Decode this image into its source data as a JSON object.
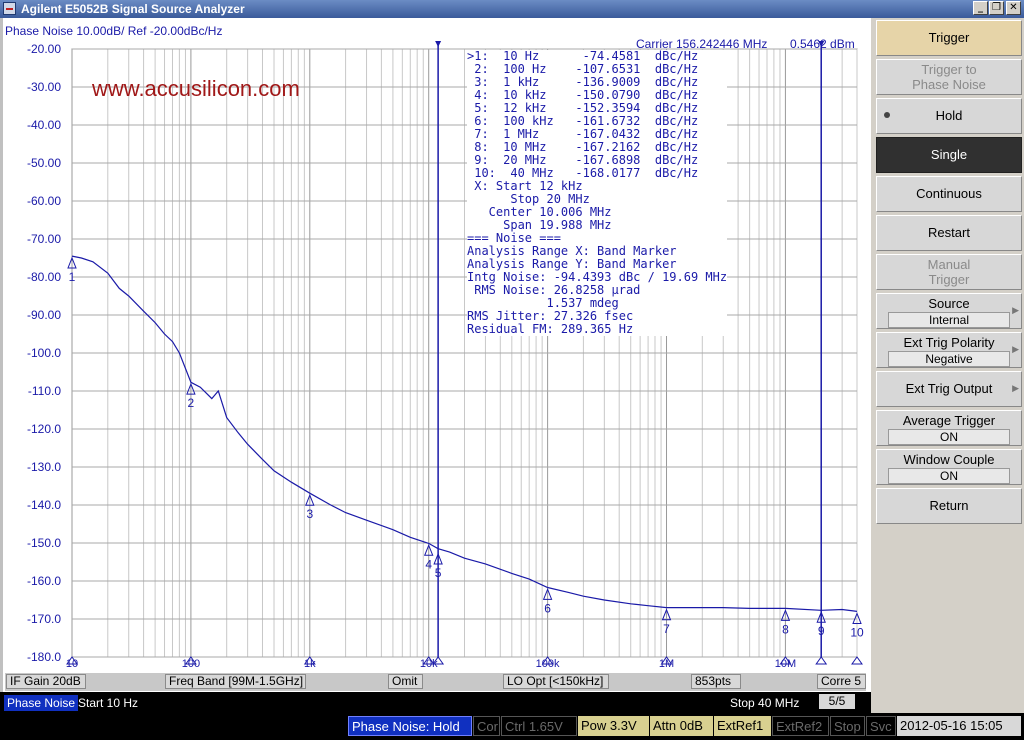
{
  "window": {
    "title": "Agilent E5052B Signal Source Analyzer"
  },
  "chart": {
    "header": "Phase Noise 10.00dB/ Ref -20.00dBc/Hz",
    "carrier": "Carrier 156.242446 MHz",
    "carrier_level": "0.5462 dBm",
    "watermark": "www.accusilicon.com"
  },
  "markers_table": [
    ">1:  10 Hz      -74.4581  dBc/Hz",
    " 2:  100 Hz    -107.6531  dBc/Hz",
    " 3:  1 kHz     -136.9009  dBc/Hz",
    " 4:  10 kHz    -150.0790  dBc/Hz",
    " 5:  12 kHz    -152.3594  dBc/Hz",
    " 6:  100 kHz   -161.6732  dBc/Hz",
    " 7:  1 MHz     -167.0432  dBc/Hz",
    " 8:  10 MHz    -167.2162  dBc/Hz",
    " 9:  20 MHz    -167.6898  dBc/Hz",
    " 10:  40 MHz   -168.0177  dBc/Hz",
    " X: Start 12 kHz",
    "      Stop 20 MHz",
    "   Center 10.006 MHz",
    "     Span 19.988 MHz",
    "=== Noise ===",
    "Analysis Range X: Band Marker",
    "Analysis Range Y: Band Marker",
    "Intg Noise: -94.4393 dBc / 19.69 MHz",
    " RMS Noise: 26.8258 µrad",
    "           1.537 mdeg",
    "RMS Jitter: 27.326 fsec",
    "Residual FM: 289.365 Hz"
  ],
  "chart_data": {
    "type": "line",
    "title": "Phase Noise 10.00dB/ Ref -20.00dBc/Hz",
    "xscale": "log",
    "xlim": [
      10,
      40000000
    ],
    "ylim": [
      -180,
      -20
    ],
    "yticks": [
      -20,
      -30,
      -40,
      -50,
      -60,
      -70,
      -80,
      -90,
      -100,
      -110,
      -120,
      -130,
      -140,
      -150,
      -160,
      -170,
      -180
    ],
    "ytick_labels": [
      "-20.00",
      "-30.00",
      "-40.00",
      "-50.00",
      "-60.00",
      "-70.00",
      "-80.00",
      "-90.00",
      "-100.0",
      "-110.0",
      "-120.0",
      "-130.0",
      "-140.0",
      "-150.0",
      "-160.0",
      "-170.0",
      "-180.0"
    ],
    "xticks": [
      10,
      100,
      1000,
      10000,
      100000,
      1000000,
      10000000
    ],
    "xtick_labels": [
      "10",
      "100",
      "1k",
      "10k",
      "100k",
      "1M",
      "10M"
    ],
    "grid": true,
    "series": [
      {
        "color": "#1a1aa8",
        "x": [
          10,
          12,
          15,
          20,
          25,
          30,
          40,
          50,
          60,
          70,
          80,
          100,
          120,
          150,
          170,
          200,
          250,
          300,
          400,
          500,
          700,
          1000,
          1500,
          2000,
          3000,
          5000,
          7000,
          10000,
          12000,
          15000,
          20000,
          30000,
          50000,
          70000,
          100000,
          150000,
          200000,
          300000,
          500000,
          700000,
          1000000,
          2000000,
          3000000,
          5000000,
          7000000,
          10000000,
          20000000,
          30000000,
          40000000
        ],
        "y": [
          -74.5,
          -75,
          -76,
          -79,
          -83,
          -85,
          -89,
          -92,
          -95,
          -97,
          -100,
          -107.7,
          -109,
          -112,
          -110,
          -117,
          -121,
          -124,
          -128,
          -131,
          -134,
          -136.9,
          -140,
          -142,
          -144,
          -146.5,
          -148.5,
          -150.1,
          -151.5,
          -152.4,
          -154,
          -155.5,
          -158,
          -159.5,
          -161.7,
          -163,
          -164,
          -165,
          -166,
          -166.5,
          -167.0,
          -167,
          -167,
          -167.2,
          -167.2,
          -167.2,
          -167.7,
          -167.5,
          -168
        ]
      }
    ],
    "markers": [
      {
        "label": "1",
        "x": 10,
        "y": -74.4581
      },
      {
        "label": "2",
        "x": 100,
        "y": -107.6531
      },
      {
        "label": "3",
        "x": 1000,
        "y": -136.9009
      },
      {
        "label": "4",
        "x": 10000,
        "y": -150.079
      },
      {
        "label": "5",
        "x": 12000,
        "y": -152.3594
      },
      {
        "label": "6",
        "x": 100000,
        "y": -161.6732
      },
      {
        "label": "7",
        "x": 1000000,
        "y": -167.0432
      },
      {
        "label": "8",
        "x": 10000000,
        "y": -167.2162
      },
      {
        "label": "9",
        "x": 20000000,
        "y": -167.6898
      },
      {
        "label": "10",
        "x": 40000000,
        "y": -168.0177
      }
    ],
    "band_lines": [
      12000,
      20000000
    ]
  },
  "status_row": {
    "if_gain": "IF Gain 20dB",
    "freq_band": "Freq Band [99M-1.5GHz]",
    "omit": "Omit",
    "lo_opt": "LO Opt [<150kHz]",
    "points": "853pts",
    "corr": "Corre 5"
  },
  "sweep_row": {
    "mode": "Phase Noise",
    "start": "Start 10 Hz",
    "stop": "Stop 40 MHz",
    "page": "5/5"
  },
  "bottom_bar": {
    "measure": "Phase Noise: Hold",
    "cor": "Cor",
    "ctrl": "Ctrl  1.65V",
    "pow": "Pow  3.3V",
    "attn": "Attn 0dB",
    "extref1": "ExtRef1",
    "extref2": "ExtRef2",
    "stop": "Stop",
    "svc": "Svc",
    "datetime": "2012-05-16 15:05"
  },
  "softkeys": {
    "title": "Trigger",
    "trigger_to_pn": "Trigger to Phase Noise",
    "hold": "Hold",
    "single": "Single",
    "continuous": "Continuous",
    "restart": "Restart",
    "manual_trigger": "Manual Trigger",
    "source_label": "Source",
    "source_value": "Internal",
    "polarity_label": "Ext Trig Polarity",
    "polarity_value": "Negative",
    "ext_trig_output": "Ext Trig Output",
    "avg_trigger_label": "Average Trigger",
    "avg_trigger_value": "ON",
    "window_couple_label": "Window Couple",
    "window_couple_value": "ON",
    "return": "Return"
  }
}
